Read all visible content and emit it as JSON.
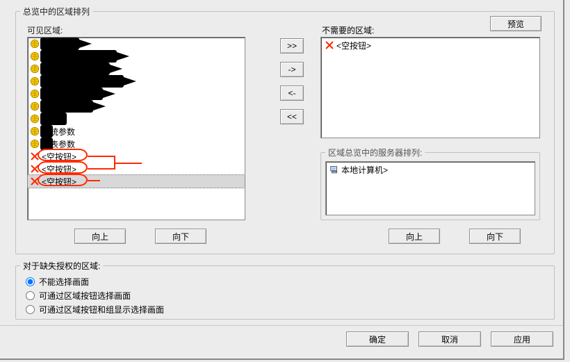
{
  "group": {
    "title": "总览中的区域排列",
    "visible_label": "可见区域:",
    "unneeded_label": "不需要的区域:",
    "server_group_title": "区域总览中的服务器排列:",
    "preview": "预览",
    "up": "向上",
    "down": "向下",
    "move_all_right": ">>",
    "move_right": "->",
    "move_left": "<-",
    "move_all_left": "<<"
  },
  "visible_items": [
    {
      "icon": "globe",
      "label": ""
    },
    {
      "icon": "globe",
      "label": ""
    },
    {
      "icon": "globe",
      "label": ""
    },
    {
      "icon": "globe",
      "label": ""
    },
    {
      "icon": "globe",
      "label": ""
    },
    {
      "icon": "globe",
      "label": ""
    },
    {
      "icon": "globe",
      "label": ""
    },
    {
      "icon": "globe",
      "label": "系统参数"
    },
    {
      "icon": "globe",
      "label": "仪表参数"
    },
    {
      "icon": "x",
      "label": "<空按钮>"
    },
    {
      "icon": "x",
      "label": "<空按钮>"
    },
    {
      "icon": "x",
      "label": "<空按钮>",
      "selected": true
    }
  ],
  "unneeded_items": [
    {
      "icon": "x",
      "label": "<空按钮>"
    }
  ],
  "server_items": [
    {
      "icon": "pc",
      "label": "本地计算机>"
    }
  ],
  "auth": {
    "title": "对于缺失授权的区域:",
    "opt1": "不能选择画面",
    "opt2": "可通过区域按钮选择画面",
    "opt3": "可通过区域按钮和组显示选择画面",
    "selected": 1
  },
  "footer": {
    "ok": "确定",
    "cancel": "取消",
    "apply": "应用"
  }
}
